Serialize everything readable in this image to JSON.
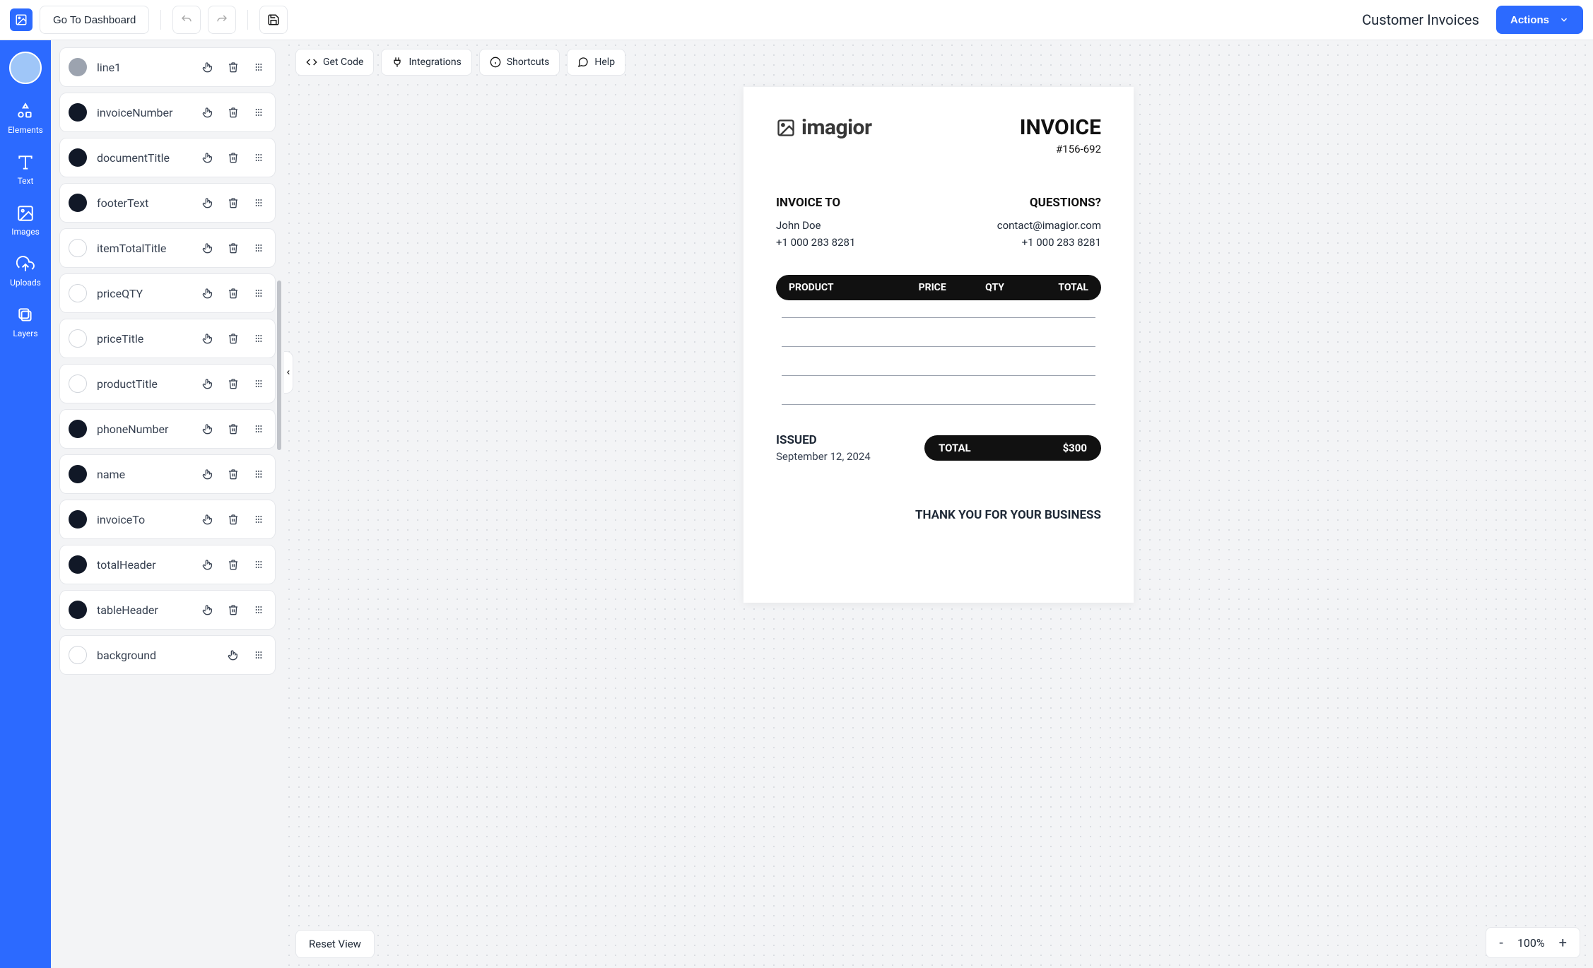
{
  "topbar": {
    "dashboard_label": "Go To Dashboard",
    "page_title": "Customer Invoices",
    "actions_label": "Actions"
  },
  "nav": {
    "elements": "Elements",
    "text": "Text",
    "images": "Images",
    "uploads": "Uploads",
    "layers": "Layers"
  },
  "layers": [
    {
      "name": "line1",
      "swatch": "sgray",
      "showDelete": true
    },
    {
      "name": "invoiceNumber",
      "swatch": "sdark",
      "showDelete": true
    },
    {
      "name": "documentTitle",
      "swatch": "sdark",
      "showDelete": true
    },
    {
      "name": "footerText",
      "swatch": "sdark",
      "showDelete": true
    },
    {
      "name": "itemTotalTitle",
      "swatch": "swhite",
      "showDelete": true
    },
    {
      "name": "priceQTY",
      "swatch": "swhite",
      "showDelete": true
    },
    {
      "name": "priceTitle",
      "swatch": "swhite",
      "showDelete": true
    },
    {
      "name": "productTitle",
      "swatch": "swhite",
      "showDelete": true
    },
    {
      "name": "phoneNumber",
      "swatch": "sdark",
      "showDelete": true
    },
    {
      "name": "name",
      "swatch": "sdark",
      "showDelete": true
    },
    {
      "name": "invoiceTo",
      "swatch": "sdark",
      "showDelete": true
    },
    {
      "name": "totalHeader",
      "swatch": "sdark",
      "showDelete": true
    },
    {
      "name": "tableHeader",
      "swatch": "sdark",
      "showDelete": true
    },
    {
      "name": "background",
      "swatch": "swhite",
      "showDelete": false
    }
  ],
  "canvas_toolbar": {
    "get_code": "Get Code",
    "integrations": "Integrations",
    "shortcuts": "Shortcuts",
    "help": "Help"
  },
  "reset_view_label": "Reset View",
  "zoom": {
    "minus": "-",
    "level": "100%",
    "plus": "+"
  },
  "invoice": {
    "brand": "imagior",
    "title": "INVOICE",
    "number": "#156-692",
    "invoice_to_head": "INVOICE TO",
    "bill_name": "John Doe",
    "bill_phone": "+1 000 283 8281",
    "questions_head": "QUESTIONS?",
    "contact_email": "contact@imagior.com",
    "contact_phone": "+1 000 283 8281",
    "th_product": "PRODUCT",
    "th_price": "PRICE",
    "th_qty": "QTY",
    "th_total": "TOTAL",
    "issued_head": "ISSUED",
    "issued_date": "September 12, 2024",
    "total_label": "TOTAL",
    "total_value": "$300",
    "thankyou": "THANK YOU FOR YOUR BUSINESS"
  }
}
